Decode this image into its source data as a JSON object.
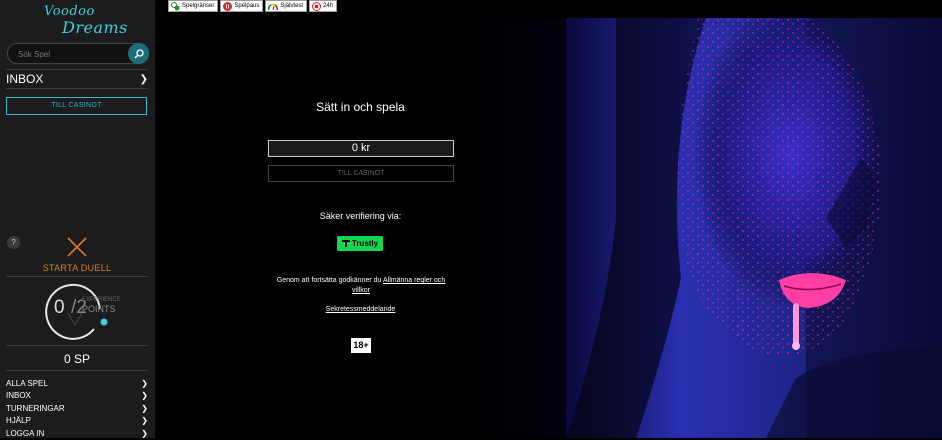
{
  "logo": {
    "line1": "Voodoo",
    "line2": "Dreams"
  },
  "search": {
    "placeholder": "Sök Spel"
  },
  "sidebar": {
    "inbox_label": "INBOX",
    "casino_button": "TILL CASINOT",
    "help_glyph": "?",
    "duel_label": "STARTA DUELL",
    "points": {
      "current": "0",
      "total": "/2",
      "caption": "EXPERIENCE",
      "unit": "POINTS",
      "progress": 0.0
    },
    "sp_label": "0 SP",
    "nav": [
      {
        "label": "ALLA SPEL"
      },
      {
        "label": "INBOX"
      },
      {
        "label": "TURNERINGAR"
      },
      {
        "label": "HJÄLP"
      },
      {
        "label": "LOGGA IN"
      }
    ]
  },
  "topbar": {
    "buttons": [
      {
        "label": "Spelgränser",
        "icon": "limits-icon"
      },
      {
        "label": "Spelpaus",
        "icon": "pause-icon"
      },
      {
        "label": "Självtest",
        "icon": "gauge-icon"
      },
      {
        "label": "24h",
        "icon": "stop-icon"
      }
    ]
  },
  "deposit": {
    "title": "Sätt in och spela",
    "amount": "0  kr",
    "cta": "TILL CASINOT",
    "verify_text": "Säker verifiering via:",
    "trustly": "Trustly",
    "terms_prefix": "Genom att fortsätta godkänner du ",
    "terms_link": "Allmänna regler och villkor",
    "privacy": "Sekretessmeddelande",
    "age": "18+"
  },
  "colors": {
    "accent": "#2fb9c6",
    "duel": "#e07b22",
    "trustly": "#11d853"
  }
}
